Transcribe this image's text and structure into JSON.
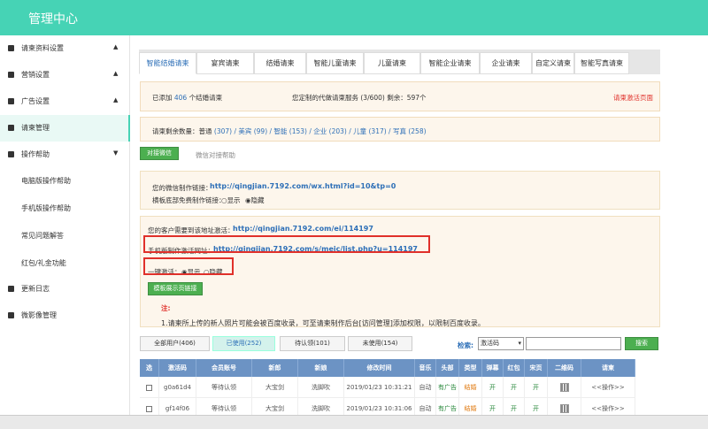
{
  "header": {
    "title": "管理中心"
  },
  "sidebar": {
    "items": [
      {
        "label": "请柬资料设置",
        "arrow": "▲"
      },
      {
        "label": "营销设置",
        "arrow": "▲"
      },
      {
        "label": "广告设置",
        "arrow": "▲"
      },
      {
        "label": "请柬管理",
        "arrow": ""
      },
      {
        "label": "操作帮助",
        "arrow": "▼"
      },
      {
        "label": "电脑版操作帮助",
        "arrow": ""
      },
      {
        "label": "手机版操作帮助",
        "arrow": ""
      },
      {
        "label": "常见问题解答",
        "arrow": ""
      },
      {
        "label": "红包/礼金功能",
        "arrow": ""
      },
      {
        "label": "更新日志",
        "arrow": ""
      },
      {
        "label": "微影像管理",
        "arrow": ""
      }
    ]
  },
  "tabs": [
    "智能结婚请柬",
    "宴宾请柬",
    "结婚请柬",
    "智能儿童请柬",
    "儿童请柬",
    "智能企业请柬",
    "企业请柬",
    "自定义请柬",
    "智能写真请柬"
  ],
  "info": {
    "added_prefix": "已添加",
    "added_count": "406",
    "added_suffix": "个结婚请柬",
    "service": "您定制的代做请柬服务 (3/600) 剩余：597个",
    "activate_link": "请柬激活页面",
    "remain_label": "请柬剩余数量：普通",
    "remain_values": "(307) / 美宾 (99) / 智能 (153) / 企业 (203) / 儿童 (317) / 写真 (258)"
  },
  "subtabs": {
    "active": "对接微信",
    "other": "微信对接帮助"
  },
  "wechat": {
    "link_label": "您的微信制作链接：",
    "link_url": "http://qingjian.7192.com/wx.html?id=10&tp=0",
    "footer_label": "横板底部免费制作链接：",
    "footer_show": "显示",
    "footer_hide": "隐藏"
  },
  "activation": {
    "label": "您的客户需要到该地址激活：",
    "url": "http://qingjian.7192.com/ei/114197",
    "mobile_label": "手机版制作激活网址：",
    "mobile_url": "http://qingjian.7192.com/s/meic/list.php?u=114197",
    "one_key_label": "一键激活：",
    "show": "显示",
    "hide": "隐藏",
    "button": "模板展示页链接"
  },
  "note": {
    "title": "注:",
    "text": "1.请柬所上传的新人照片可能会被百度收录，可至请柬制作后台[访问管理]添加权限，以限制百度收录。"
  },
  "filter": {
    "tabs": [
      "全部用户(406)",
      "已使用(252)",
      "待认领(101)",
      "未使用(154)"
    ],
    "search_label": "检索:",
    "search_select": "激活码",
    "search_button": "搜索"
  },
  "table": {
    "headers": [
      "选",
      "激活码",
      "会员账号",
      "新郎",
      "新娘",
      "修改时间",
      "音乐",
      "头部",
      "类型",
      "弹幕",
      "红包",
      "宋页",
      "二维码",
      "请柬"
    ],
    "rows": [
      [
        "",
        "g0a61d4",
        "等待认领",
        "大宝剑",
        "洗脚吹",
        "2019/01/23 10:31:21",
        "自动",
        "有广告",
        "结婚",
        "开",
        "开",
        "开",
        "",
        "<<操作>>"
      ],
      [
        "",
        "gf14f06",
        "等待认领",
        "大宝剑",
        "洗脚吹",
        "2019/01/23 10:31:06",
        "自动",
        "有广告",
        "结婚",
        "开",
        "开",
        "开",
        "",
        "<<操作>>"
      ]
    ]
  }
}
